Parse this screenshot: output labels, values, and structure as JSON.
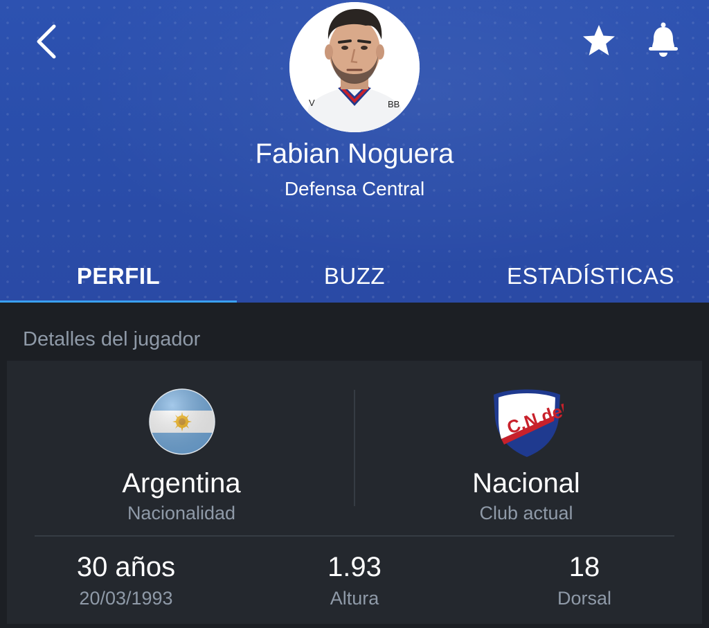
{
  "header": {
    "player_name": "Fabian Noguera",
    "player_position": "Defensa Central",
    "back_icon": "chevron-left-icon",
    "favorite_icon": "star-icon",
    "notifications_icon": "bell-icon",
    "background_color": "#2b4fac"
  },
  "tabs": [
    {
      "label": "PERFIL",
      "active": true
    },
    {
      "label": "BUZZ",
      "active": false
    },
    {
      "label": "ESTADÍSTICAS",
      "active": false
    }
  ],
  "active_tab_color": "#3aa0f0",
  "details": {
    "section_title": "Detalles del jugador",
    "nationality": {
      "value": "Argentina",
      "label": "Nacionalidad",
      "icon": "argentina-flag-icon"
    },
    "club": {
      "value": "Nacional",
      "label": "Club actual",
      "icon": "club-nacional-crest-icon",
      "crest_text": "C.N.deF."
    },
    "age": {
      "value": "30 años",
      "label": "20/03/1993"
    },
    "height": {
      "value": "1.93",
      "label": "Altura"
    },
    "number": {
      "value": "18",
      "label": "Dorsal"
    }
  }
}
